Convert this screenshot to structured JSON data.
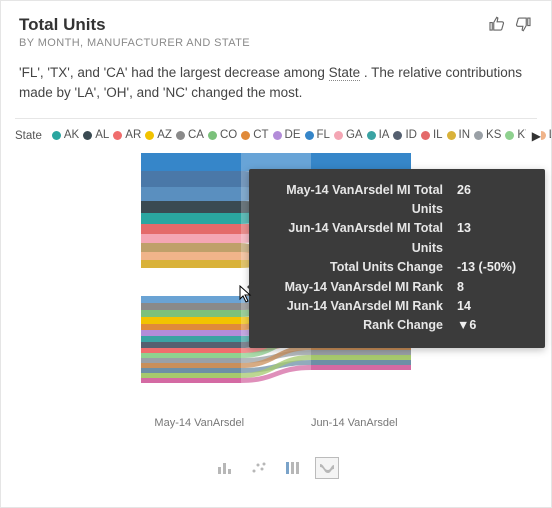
{
  "header": {
    "title": "Total Units",
    "subtitle": "BY MONTH, MANUFACTURER AND STATE"
  },
  "narrative": {
    "part1": "'FL', 'TX', and 'CA' had the largest decrease among ",
    "linked": "State",
    "part2": " . The relative contributions made by 'LA', 'OH', and 'NC' changed the most."
  },
  "legend": {
    "label": "State",
    "items": [
      {
        "code": "AK",
        "color": "#2aa6a0"
      },
      {
        "code": "AL",
        "color": "#3a4a52"
      },
      {
        "code": "AR",
        "color": "#f06d6d"
      },
      {
        "code": "AZ",
        "color": "#f2c300"
      },
      {
        "code": "CA",
        "color": "#8a8a8a"
      },
      {
        "code": "CO",
        "color": "#7bc17b"
      },
      {
        "code": "CT",
        "color": "#e08a3a"
      },
      {
        "code": "DE",
        "color": "#b38cd9"
      },
      {
        "code": "FL",
        "color": "#3686c9"
      },
      {
        "code": "GA",
        "color": "#f4a6b4"
      },
      {
        "code": "IA",
        "color": "#3aa3a3"
      },
      {
        "code": "ID",
        "color": "#556070"
      },
      {
        "code": "IL",
        "color": "#e46a6a"
      },
      {
        "code": "IN",
        "color": "#d9b23a"
      },
      {
        "code": "KS",
        "color": "#9aa0a6"
      },
      {
        "code": "KY",
        "color": "#8fd18f"
      },
      {
        "code": "LA",
        "color": "#f0b48a"
      }
    ]
  },
  "axis": {
    "left": "May-14 VanArsdel",
    "right": "Jun-14 VanArsdel"
  },
  "tooltip": {
    "rows": [
      {
        "k": "May-14 VanArsdel MI Total Units",
        "v": "26"
      },
      {
        "k": "Jun-14 VanArsdel MI Total Units",
        "v": "13"
      },
      {
        "k": "Total Units Change",
        "v": "-13 (-50%)"
      },
      {
        "k": "May-14 VanArsdel MI Rank",
        "v": "8"
      },
      {
        "k": "Jun-14 VanArsdel MI Rank",
        "v": "14"
      },
      {
        "k": "Rank Change",
        "v": "▼6"
      }
    ]
  },
  "chart_data": {
    "type": "area",
    "note": "Ribbon / rank-flow chart; each series is a State, width proportional to Total Units, vertical order = rank.",
    "categories": [
      "May-14 VanArsdel",
      "Jun-14 VanArsdel"
    ],
    "highlighted_series": "MI",
    "series": [
      {
        "name": "MI",
        "color": "#bfa06a",
        "total_units": [
          26,
          13
        ],
        "rank": [
          8,
          14
        ]
      }
    ],
    "rank_change_highlight": -6,
    "total_units_change_highlight": {
      "abs": -13,
      "pct": -50
    }
  }
}
